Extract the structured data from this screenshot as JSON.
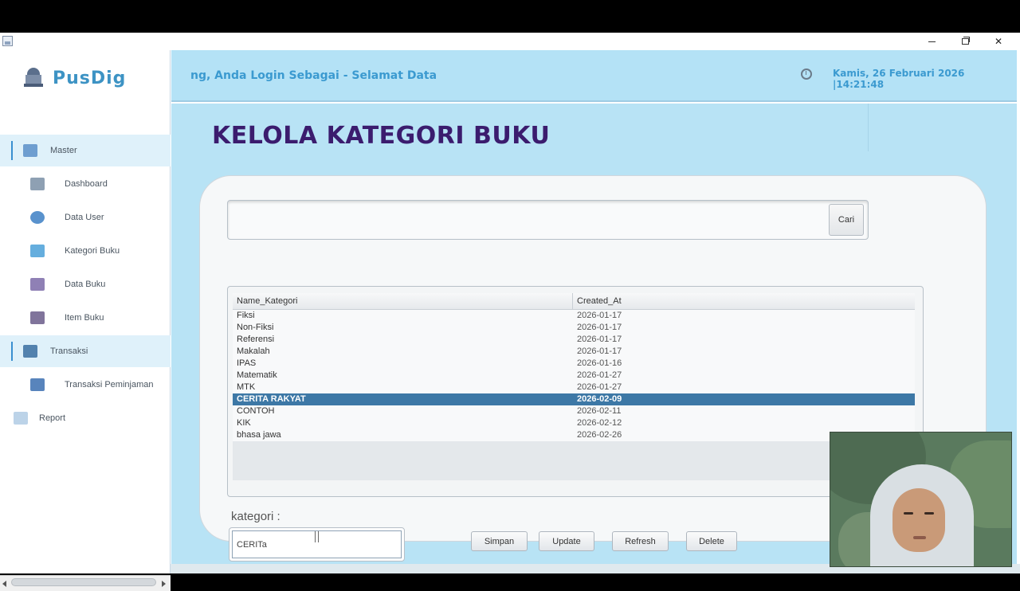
{
  "window": {
    "controls": {
      "minimize": "minimize",
      "maximize": "restore",
      "close": "close"
    }
  },
  "sidebar": {
    "brand": "PusDig",
    "items": [
      {
        "label": "Master",
        "icon": "master-icon",
        "section": true
      },
      {
        "label": "Dashboard",
        "icon": "dashboard-icon",
        "section": false
      },
      {
        "label": "Data User",
        "icon": "user-icon",
        "section": false
      },
      {
        "label": "Kategori Buku",
        "icon": "category-icon",
        "section": false
      },
      {
        "label": "Data Buku",
        "icon": "books-icon",
        "section": false
      },
      {
        "label": "Item Buku",
        "icon": "item-book-icon",
        "section": false
      },
      {
        "label": "Transaksi",
        "icon": "transaction-icon",
        "section": true
      },
      {
        "label": "Transaksi Peminjaman",
        "icon": "loan-icon",
        "section": false
      },
      {
        "label": "Report",
        "icon": "report-icon",
        "section": false
      }
    ]
  },
  "header": {
    "welcome": "ng, Anda Login Sebagai  - Selamat Data",
    "datetime": "Kamis, 26 Februari 2026 |14:21:48"
  },
  "main": {
    "title": "KELOLA KATEGORI BUKU",
    "search": {
      "value": "",
      "button": "Cari"
    },
    "table": {
      "columns": [
        "Name_Kategori",
        "Created_At"
      ],
      "rows": [
        [
          "Fiksi",
          "2026-01-17"
        ],
        [
          "Non-Fiksi",
          "2026-01-17"
        ],
        [
          "Referensi",
          "2026-01-17"
        ],
        [
          "Makalah",
          "2026-01-17"
        ],
        [
          "IPAS",
          "2026-01-16"
        ],
        [
          "Matematik",
          "2026-01-27"
        ],
        [
          "MTK",
          "2026-01-27"
        ],
        [
          "CERITA RAKYAT",
          "2026-02-09"
        ],
        [
          "CONTOH",
          "2026-02-11"
        ],
        [
          "KIK",
          "2026-02-12"
        ],
        [
          "bhasa jawa",
          "2026-02-26"
        ]
      ],
      "selected_index": 7
    },
    "form": {
      "label": "kategori :",
      "value": "CERITa"
    },
    "buttons": {
      "simpan": "Simpan",
      "update": "Update",
      "refresh": "Refresh",
      "delete": "Delete"
    }
  },
  "colors": {
    "header_bg": "#b4e2f6",
    "accent": "#3b9ad0",
    "title": "#3b1c6e",
    "selected_row": "#3d78a6"
  }
}
